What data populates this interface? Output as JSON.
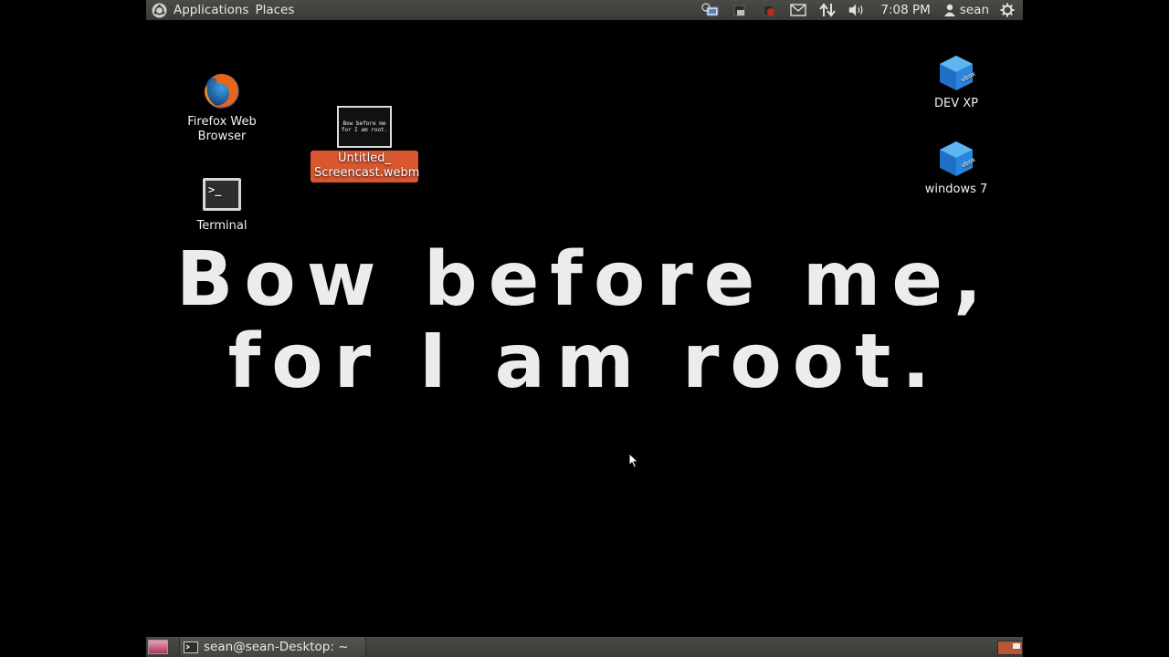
{
  "top_panel": {
    "menus": [
      "Applications",
      "Places"
    ],
    "clock": "7:08 PM",
    "user": "sean"
  },
  "desktop": {
    "icons": {
      "firefox": [
        "Firefox Web",
        "Browser"
      ],
      "terminal": [
        "Terminal"
      ],
      "screencast": [
        "Untitled_",
        "Screencast.webm"
      ],
      "screencast_thumb": [
        "Bow before me",
        "for I am root."
      ],
      "devxp": [
        "DEV XP"
      ],
      "win7": [
        "windows 7"
      ],
      "vbox_badge": "vbox"
    },
    "banner": [
      "Bow before me,",
      "for I am root."
    ]
  },
  "bottom_panel": {
    "task": "sean@sean-Desktop: ~"
  },
  "colors": {
    "selection": "#d9572f",
    "panel": "#3f3f3c"
  },
  "icon_names": [
    "ubuntu-logo-icon",
    "network-icon",
    "battery-icon",
    "recording-icon",
    "mail-icon",
    "transfer-icon",
    "volume-icon",
    "user-icon",
    "power-gear-icon"
  ]
}
